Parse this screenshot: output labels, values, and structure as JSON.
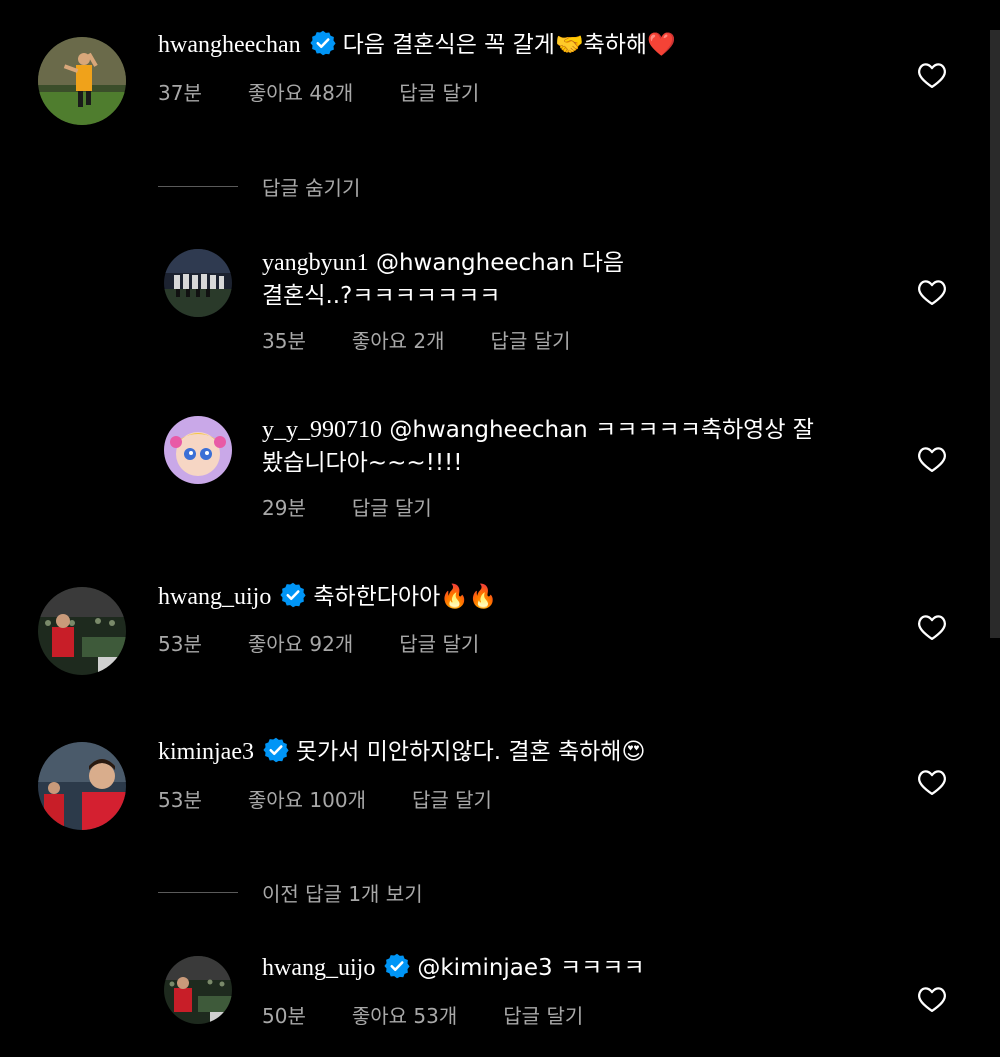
{
  "comments": [
    {
      "username": "hwangheechan",
      "verified": true,
      "text": "다음 결혼식은 꼭 갈게🤝축하해❤️",
      "time": "37분",
      "likes": "좋아요 48개",
      "reply": "답글 달기"
    },
    {
      "username": "hwang_uijo",
      "verified": true,
      "text": "축하한다아아🔥🔥",
      "time": "53분",
      "likes": "좋아요 92개",
      "reply": "답글 달기"
    },
    {
      "username": "kiminjae3",
      "verified": true,
      "text": "못가서 미안하지않다. 결혼 축하해😍",
      "time": "53분",
      "likes": "좋아요 100개",
      "reply": "답글 달기"
    }
  ],
  "thread1": {
    "toggle_label": "답글 숨기기",
    "replies": [
      {
        "username": "yangbyun1",
        "text_line1": "@hwangheechan 다음",
        "text_line2": "결혼식..?ㅋㅋㅋㅋㅋㅋㅋ",
        "time": "35분",
        "likes": "좋아요 2개",
        "reply": "답글 달기"
      },
      {
        "username": "y_y_990710",
        "text_line1": "@hwangheechan ㅋㅋㅋㅋㅋ축하영상 잘",
        "text_line2": "봤습니다아~~~!!!!",
        "time": "29분",
        "reply": "답글 달기"
      }
    ]
  },
  "thread2": {
    "toggle_label": "이전 답글 1개 보기",
    "replies": [
      {
        "username": "hwang_uijo",
        "verified": true,
        "text": "@kiminjae3 ㅋㅋㅋㅋ",
        "time": "50분",
        "likes": "좋아요 53개",
        "reply": "답글 달기"
      }
    ]
  },
  "icons": {
    "like": "heart-outline-icon",
    "verified": "verified-badge-icon"
  },
  "colors": {
    "background": "#000000",
    "text": "#ffffff",
    "secondary_text": "#a8a8a8",
    "verified_blue": "#0095f6"
  }
}
